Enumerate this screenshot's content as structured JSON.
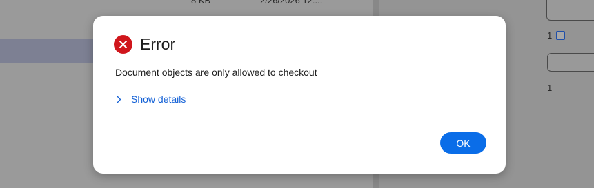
{
  "background": {
    "row_size": "8 KB",
    "row_date": "2/26/2026 12:...",
    "right_panel_count_1": "1",
    "right_panel_count_2": "1"
  },
  "dialog": {
    "icon": "error-x-icon",
    "title": "Error",
    "message": "Document objects are only allowed to checkout",
    "details_toggle_label": "Show details",
    "ok_label": "OK",
    "colors": {
      "error_icon": "#d0161c",
      "link": "#1461d6",
      "primary_button": "#0a6de8"
    }
  }
}
